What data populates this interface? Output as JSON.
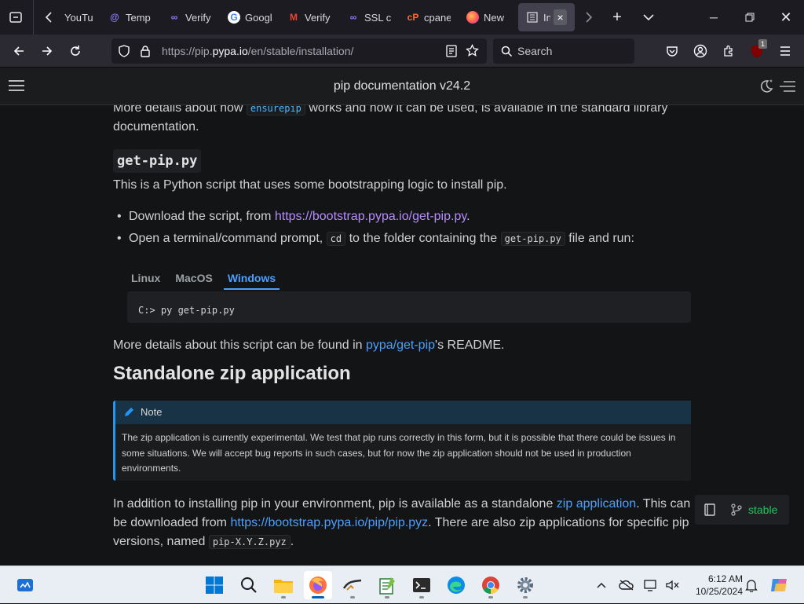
{
  "browser": {
    "tabs": [
      {
        "title": "YouTu",
        "icon": "youtube-icon"
      },
      {
        "title": "Temp",
        "icon": "at-mail-icon"
      },
      {
        "title": "Verify",
        "icon": "infinity-icon"
      },
      {
        "title": "Googl",
        "icon": "google-icon"
      },
      {
        "title": "Verify",
        "icon": "gmail-icon"
      },
      {
        "title": "SSL ce",
        "icon": "infinity-icon"
      },
      {
        "title": "cpane",
        "icon": "cpanel-icon"
      },
      {
        "title": "New T",
        "icon": "firefox-icon"
      },
      {
        "title": "In",
        "icon": "reader-icon",
        "active": true
      }
    ],
    "url": {
      "scheme": "https://pip.",
      "host": "pypa.io",
      "path": "/en/stable/installation/"
    },
    "search_placeholder": "Search",
    "extension_badge": "1"
  },
  "site": {
    "header_title": "pip documentation v24.2"
  },
  "content": {
    "intro_1": "More details about how ",
    "intro_code": "ensurepip",
    "intro_2": " works and how it can be used, is available in the standard library documentation.",
    "h_getpip": "get-pip.py",
    "getpip_desc": "This is a Python script that uses some bootstrapping logic to install pip.",
    "bullet1_text": "Download the script, from ",
    "bullet1_link": "https://bootstrap.pypa.io/get-pip.py",
    "bullet1_end": ".",
    "bullet2_a": "Open a terminal/command prompt, ",
    "bullet2_code1": "cd",
    "bullet2_b": " to the folder containing the ",
    "bullet2_code2": "get-pip.py",
    "bullet2_c": " file and run:",
    "os_tabs": [
      "Linux",
      "MacOS",
      "Windows"
    ],
    "active_os_tab": "Windows",
    "command": "C:> py get-pip.py",
    "more_1": "More details about this script can be found in ",
    "more_link": "pypa/get-pip",
    "more_2": "'s README.",
    "h_zip": "Standalone zip application",
    "note_title": "Note",
    "note_body": "The zip application is currently experimental. We test that pip runs correctly in this form, but it is possible that there could be issues in some situations. We will accept bug reports in such cases, but for now the zip application should not be used in production environments.",
    "zip_1": "In addition to installing pip in your environment, pip is available as a standalone ",
    "zip_link1": "zip application",
    "zip_2": ". This can be downloaded from ",
    "zip_link2": "https://bootstrap.pypa.io/pip/pip.pyz",
    "zip_3": ". There are also zip applications for specific pip versions, named ",
    "zip_code": "pip-X.Y.Z.pyz",
    "zip_4": "."
  },
  "version_switcher": {
    "label": "stable"
  },
  "taskbar": {
    "apps": [
      "widgets-icon",
      "start-icon",
      "search-icon",
      "file-explorer-icon",
      "firefox-icon",
      "snipping-icon",
      "notepad-plus-icon",
      "terminal-icon",
      "edge-icon",
      "chrome-icon",
      "settings-icon",
      "copilot-icon"
    ],
    "time": "6:12 AM",
    "date": "10/25/2024"
  },
  "colors": {
    "accent_blue": "#4b9fff",
    "visited_link": "#b78cff",
    "stable_green": "#23c55e",
    "note_border": "#2196f3"
  }
}
